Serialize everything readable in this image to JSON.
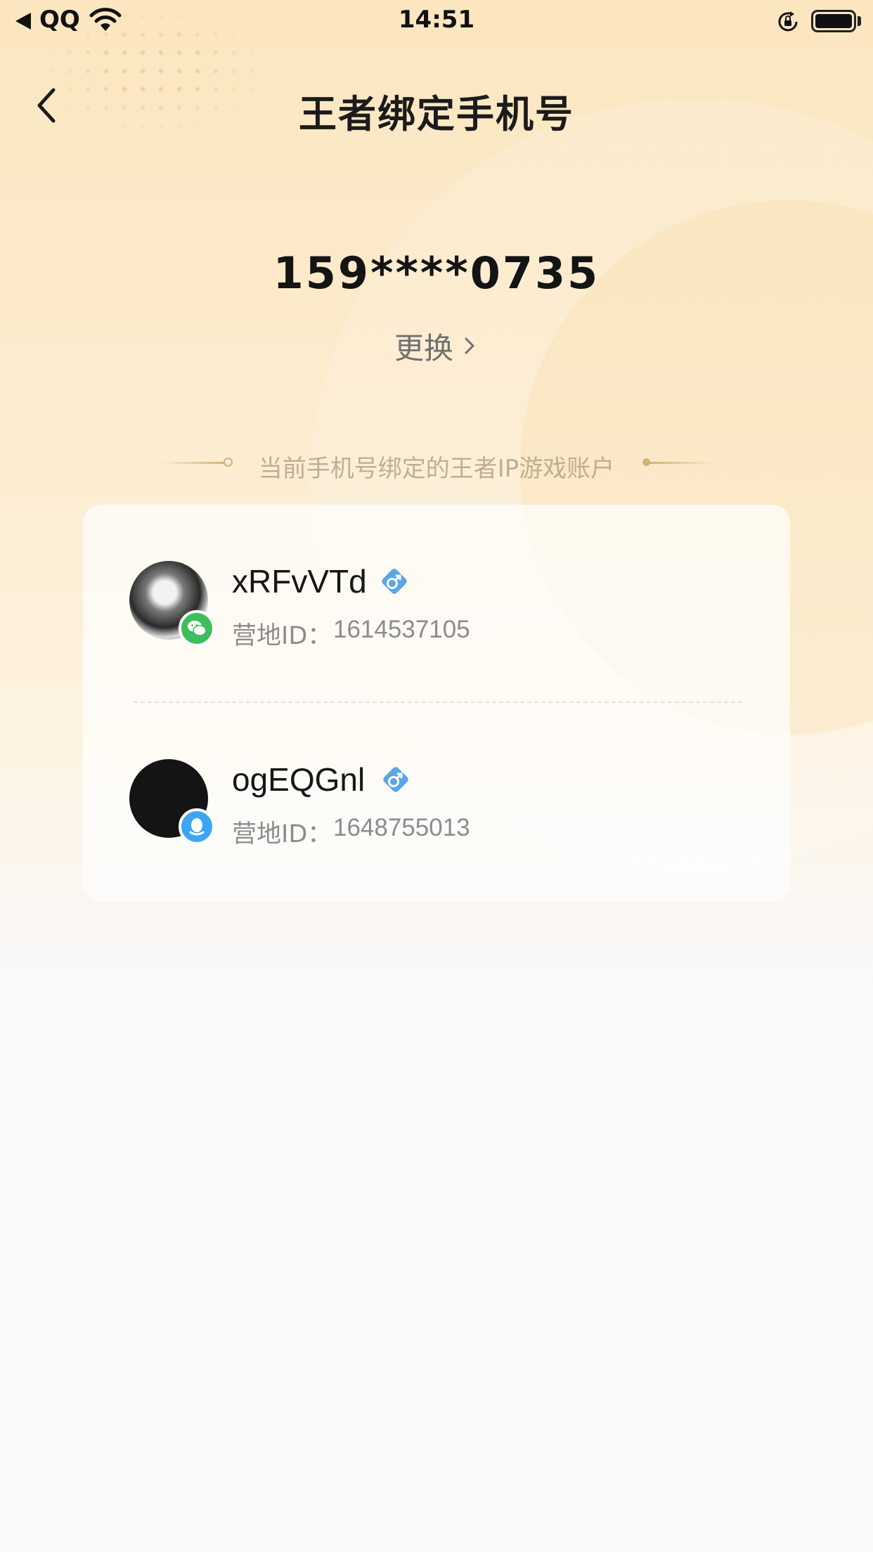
{
  "status_bar": {
    "carrier": "QQ",
    "time": "14:51"
  },
  "nav": {
    "title": "王者绑定手机号"
  },
  "phone": {
    "number": "159****0735",
    "change_label": "更换"
  },
  "section": {
    "title": "当前手机号绑定的王者IP游戏账户"
  },
  "accounts": [
    {
      "name": "xRFvVTd",
      "id_label": "营地ID：",
      "id": "1614537105",
      "platform": "wechat-icon",
      "gender": "male-icon"
    },
    {
      "name": "ogEQGnl",
      "id_label": "营地ID：",
      "id": "1648755013",
      "platform": "qq-icon",
      "gender": "male-icon"
    }
  ],
  "colors": {
    "accent_gold": "#d4b27a",
    "wechat_green": "#3dbd5c",
    "qq_blue": "#3ea5f2",
    "gender_blue": "#5aa6e6"
  }
}
